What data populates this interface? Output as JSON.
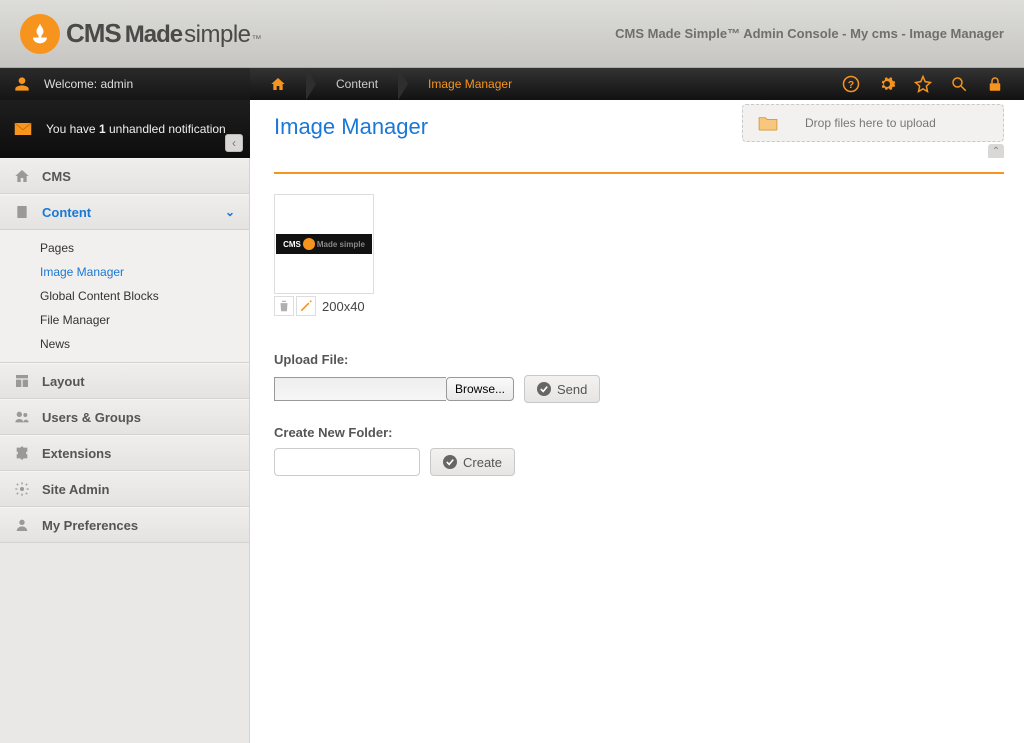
{
  "header": {
    "logo": {
      "cms": "CMS",
      "made": "Made",
      "simple": "simple",
      "tm": "™"
    },
    "title": "CMS Made Simple™ Admin Console - My cms - Image Manager"
  },
  "topbar": {
    "welcome": "Welcome: admin",
    "breadcrumb": {
      "content": "Content",
      "current": "Image Manager"
    }
  },
  "notification": {
    "text_prefix": "You have ",
    "count": "1",
    "text_suffix": " unhandled notification"
  },
  "sidebar": {
    "items": [
      {
        "label": "CMS"
      },
      {
        "label": "Content"
      },
      {
        "label": "Layout"
      },
      {
        "label": "Users & Groups"
      },
      {
        "label": "Extensions"
      },
      {
        "label": "Site Admin"
      },
      {
        "label": "My Preferences"
      }
    ],
    "sub": [
      {
        "label": "Pages"
      },
      {
        "label": "Image Manager"
      },
      {
        "label": "Global Content Blocks"
      },
      {
        "label": "File Manager"
      },
      {
        "label": "News"
      }
    ]
  },
  "main": {
    "page_title": "Image Manager",
    "dropzone": "Drop files here to upload",
    "thumb_label": "200x40",
    "upload_label": "Upload File:",
    "browse_btn": "Browse...",
    "send_btn": "Send",
    "folder_label": "Create New Folder:",
    "create_btn": "Create"
  }
}
